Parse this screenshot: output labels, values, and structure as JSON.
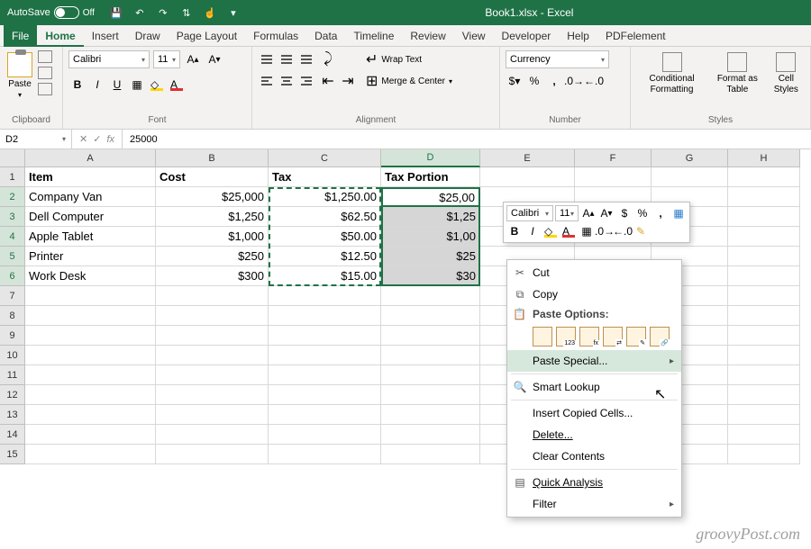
{
  "titlebar": {
    "autosave_label": "AutoSave",
    "autosave_state": "Off",
    "title": "Book1.xlsx - Excel"
  },
  "ribbon_tabs": [
    "File",
    "Home",
    "Insert",
    "Draw",
    "Page Layout",
    "Formulas",
    "Data",
    "Timeline",
    "Review",
    "View",
    "Developer",
    "Help",
    "PDFelement"
  ],
  "ribbon": {
    "clipboard": {
      "paste": "Paste",
      "label": "Clipboard"
    },
    "font": {
      "name": "Calibri",
      "size": "11",
      "label": "Font"
    },
    "alignment": {
      "wrap": "Wrap Text",
      "merge": "Merge & Center",
      "label": "Alignment"
    },
    "number": {
      "format": "Currency",
      "label": "Number"
    },
    "styles": {
      "cond": "Conditional Formatting",
      "table": "Format as Table",
      "cell": "Cell Styles",
      "label": "Styles"
    }
  },
  "formula": {
    "namebox": "D2",
    "fx": "fx",
    "content": "25000"
  },
  "columns": [
    "A",
    "B",
    "C",
    "D",
    "E",
    "F",
    "G",
    "H"
  ],
  "data": {
    "headers": [
      "Item",
      "Cost",
      "Tax",
      "Tax Portion"
    ],
    "rows": [
      {
        "item": "Company Van",
        "cost": "$25,000",
        "tax": "$1,250.00",
        "portion": "$25,00"
      },
      {
        "item": "Dell Computer",
        "cost": "$1,250",
        "tax": "$62.50",
        "portion": "$1,25"
      },
      {
        "item": "Apple Tablet",
        "cost": "$1,000",
        "tax": "$50.00",
        "portion": "$1,00"
      },
      {
        "item": "Printer",
        "cost": "$250",
        "tax": "$12.50",
        "portion": "$25"
      },
      {
        "item": "Work Desk",
        "cost": "$300",
        "tax": "$15.00",
        "portion": "$30"
      }
    ]
  },
  "mini_toolbar": {
    "font": "Calibri",
    "size": "11"
  },
  "context_menu": {
    "cut": "Cut",
    "copy": "Copy",
    "paste_options": "Paste Options:",
    "paste_special": "Paste Special...",
    "smart_lookup": "Smart Lookup",
    "insert_copied": "Insert Copied Cells...",
    "delete": "Delete...",
    "clear": "Clear Contents",
    "quick_analysis": "Quick Analysis",
    "filter": "Filter"
  },
  "watermark": "groovyPost.com"
}
